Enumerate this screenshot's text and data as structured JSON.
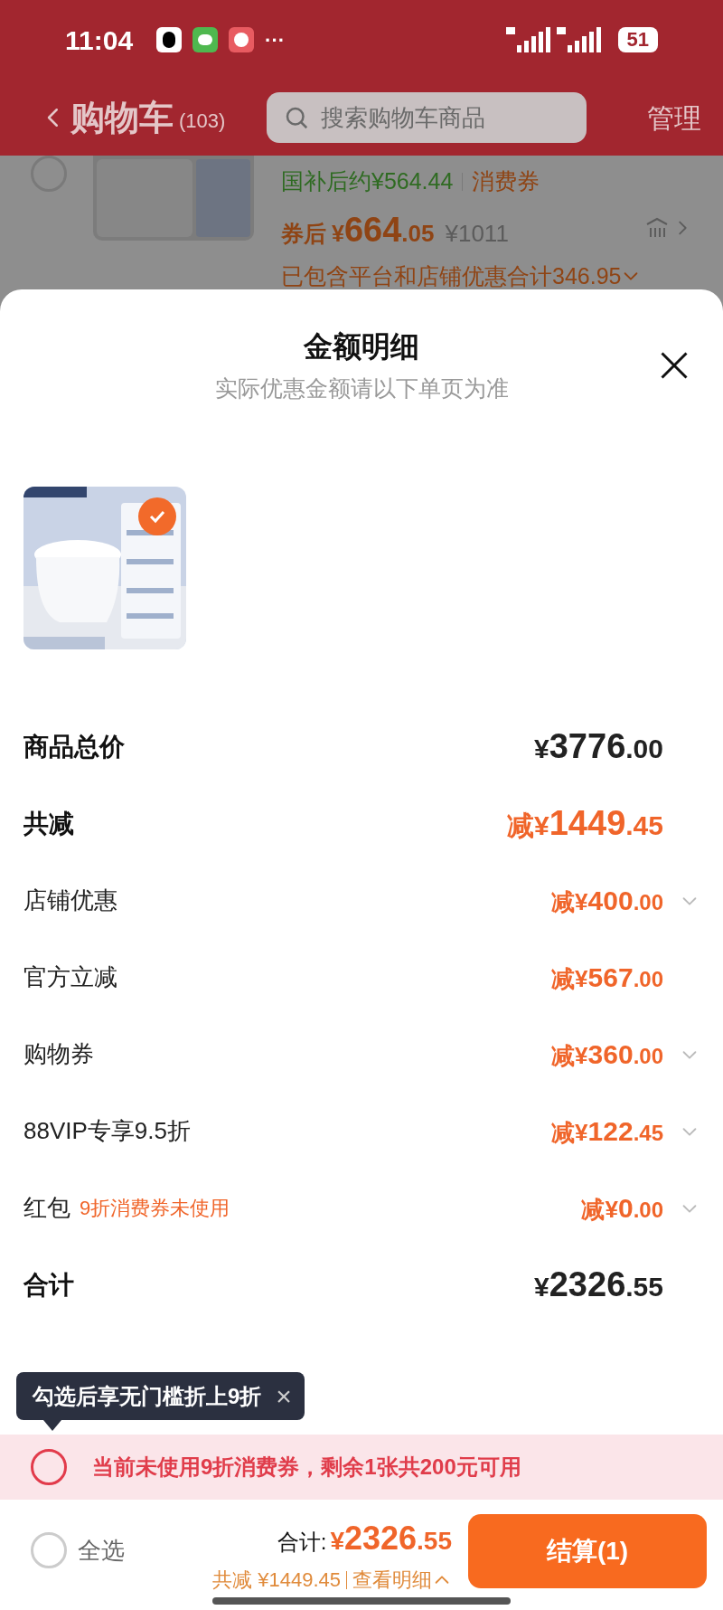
{
  "status_bar": {
    "time": "11:04",
    "more": "···",
    "battery": "51"
  },
  "header": {
    "title": "购物车",
    "count": "(103)",
    "search": {
      "placeholder": "搜索购物车商品"
    },
    "action": "管理"
  },
  "background_item": {
    "checked": false,
    "subsidy_price": "国补后约¥564.44",
    "tag": "消费券",
    "price_label": "券后",
    "price": {
      "symbol": "¥",
      "int": "664",
      "dec": ".05"
    },
    "original_price": "¥1011",
    "discount_note": "已包含平台和店铺优惠合计346.95"
  },
  "sheet": {
    "title": "金额明细",
    "subtitle": "实际优惠金额请以下单页为准",
    "product": {
      "kind": "picture",
      "selected": true
    },
    "rows": [
      {
        "kind": "major",
        "label": "商品总价",
        "prefix": "",
        "symbol": "¥",
        "int": "3776",
        "dec": ".00",
        "highlight": false,
        "expandable": false
      },
      {
        "kind": "major",
        "label": "共减",
        "prefix": "减",
        "symbol": "¥",
        "int": "1449",
        "dec": ".45",
        "highlight": true,
        "expandable": false
      },
      {
        "kind": "minor",
        "label": "店铺优惠",
        "prefix": "减",
        "symbol": "¥",
        "int": "400",
        "dec": ".00",
        "highlight": true,
        "expandable": true
      },
      {
        "kind": "minor",
        "label": "官方立减",
        "prefix": "减",
        "symbol": "¥",
        "int": "567",
        "dec": ".00",
        "highlight": true,
        "expandable": false
      },
      {
        "kind": "minor",
        "label": "购物券",
        "prefix": "减",
        "symbol": "¥",
        "int": "360",
        "dec": ".00",
        "highlight": true,
        "expandable": true
      },
      {
        "kind": "minor",
        "label": "88VIP专享9.5折",
        "prefix": "减",
        "symbol": "¥",
        "int": "122",
        "dec": ".45",
        "highlight": true,
        "expandable": true
      },
      {
        "kind": "minor",
        "label": "红包",
        "note": "9折消费券未使用",
        "prefix": "减",
        "symbol": "¥",
        "int": "0",
        "dec": ".00",
        "highlight": true,
        "expandable": true
      },
      {
        "kind": "major",
        "label": "合计",
        "prefix": "",
        "symbol": "¥",
        "int": "2326",
        "dec": ".55",
        "highlight": false,
        "expandable": false
      }
    ]
  },
  "tooltip": {
    "text": "勾选后享无门槛折上9折",
    "close": "×"
  },
  "coupon_bar": {
    "checked": false,
    "text": "当前未使用9折消费券，剩余1张共200元可用"
  },
  "footer": {
    "select_all": {
      "checked": false,
      "label": "全选"
    },
    "total_label": "合计:",
    "total": {
      "symbol": "¥",
      "int": "2326",
      "dec": ".55"
    },
    "saving": "共减 ¥1449.45",
    "details_link": "查看明细",
    "checkout": "结算(1)"
  }
}
